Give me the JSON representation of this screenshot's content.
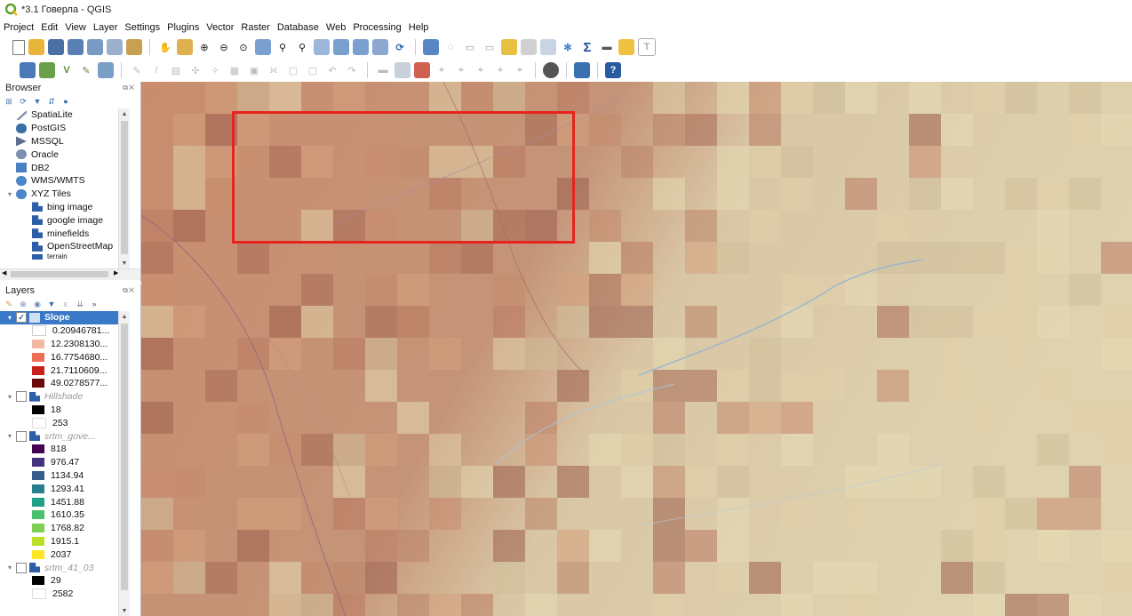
{
  "window": {
    "title": "*3.1 Говерла - QGIS"
  },
  "menu": [
    "Project",
    "Edit",
    "View",
    "Layer",
    "Settings",
    "Plugins",
    "Vector",
    "Raster",
    "Database",
    "Web",
    "Processing",
    "Help"
  ],
  "browser": {
    "title": "Browser",
    "items": [
      {
        "label": "SpatiaLite",
        "icon": "spatialite-icon",
        "color": "#6b7fa0"
      },
      {
        "label": "PostGIS",
        "icon": "postgis-icon",
        "color": "#3b6ea5"
      },
      {
        "label": "MSSQL",
        "icon": "mssql-icon",
        "color": "#5c6f8f"
      },
      {
        "label": "Oracle",
        "icon": "oracle-icon",
        "color": "#7b8fb0"
      },
      {
        "label": "DB2",
        "icon": "db2-icon",
        "color": "#4a7fc0"
      },
      {
        "label": "WMS/WMTS",
        "icon": "wms-icon",
        "color": "#4b86c8"
      },
      {
        "label": "XYZ Tiles",
        "icon": "xyz-icon",
        "color": "#4b86c8"
      },
      {
        "label": "bing image",
        "icon": "tile-icon",
        "color": "#2d5fa8"
      },
      {
        "label": "google image",
        "icon": "tile-icon",
        "color": "#2d5fa8"
      },
      {
        "label": "minefields",
        "icon": "tile-icon",
        "color": "#2d5fa8"
      },
      {
        "label": "OpenStreetMap",
        "icon": "tile-icon",
        "color": "#2d5fa8"
      },
      {
        "label": "terrain",
        "icon": "tile-icon",
        "color": "#2d5fa8"
      }
    ]
  },
  "layers": {
    "title": "Layers",
    "slope": {
      "name": "Slope",
      "checked": "✓",
      "legend": [
        {
          "label": "0.20946781...",
          "color": "#ffffff"
        },
        {
          "label": "12.2308130...",
          "color": "#f6b8a3"
        },
        {
          "label": "16.7754680...",
          "color": "#ef6f55"
        },
        {
          "label": "21.7110609...",
          "color": "#c9201c"
        },
        {
          "label": "49.0278577...",
          "color": "#6b0a0a"
        }
      ]
    },
    "hillshade": {
      "name": "Hillshade",
      "legend": [
        {
          "label": "18",
          "color": "#000000"
        },
        {
          "label": "253",
          "color": "#ffffff"
        }
      ]
    },
    "srtm_gove": {
      "name": "srtm_gove...",
      "legend": [
        {
          "label": "818",
          "color": "#440154"
        },
        {
          "label": "976.47",
          "color": "#46327e"
        },
        {
          "label": "1134.94",
          "color": "#365c8d"
        },
        {
          "label": "1293.41",
          "color": "#277f8e"
        },
        {
          "label": "1451.88",
          "color": "#1fa187"
        },
        {
          "label": "1610.35",
          "color": "#4ac16d"
        },
        {
          "label": "1768.82",
          "color": "#7ad151"
        },
        {
          "label": "1915.1",
          "color": "#bddf26"
        },
        {
          "label": "2037",
          "color": "#fde725"
        }
      ]
    },
    "srtm_41": {
      "name": "srtm_41_03",
      "legend": [
        {
          "label": "29",
          "color": "#000000"
        },
        {
          "label": "2582",
          "color": "#ffffff"
        }
      ]
    }
  }
}
